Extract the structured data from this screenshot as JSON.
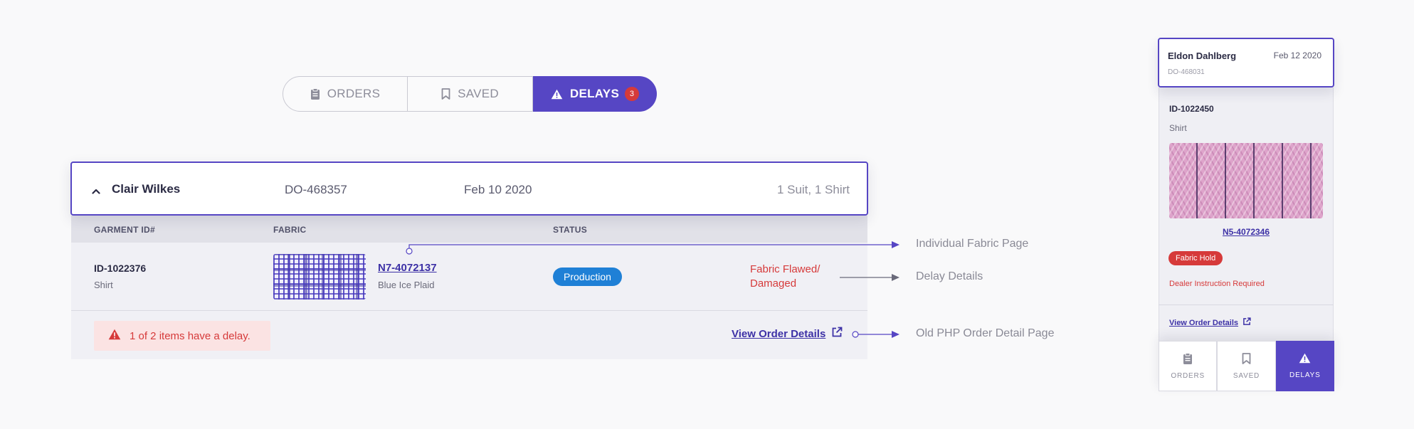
{
  "tabs": {
    "orders_label": "ORDERS",
    "saved_label": "SAVED",
    "delays_label": "DELAYS",
    "delays_count": "3",
    "active": "delays"
  },
  "order": {
    "customer": "Clair Wilkes",
    "order_id": "DO-468357",
    "date": "Feb 10 2020",
    "items_summary": "1 Suit, 1 Shirt",
    "columns": {
      "garment": "GARMENT ID#",
      "fabric": "FABRIC",
      "status": "STATUS"
    },
    "row": {
      "garment_id": "ID-1022376",
      "garment_type": "Shirt",
      "fabric_code": "N7-4072137",
      "fabric_name": "Blue Ice Plaid",
      "status": "Production",
      "delay_reason": "Fabric Flawed/ Damaged"
    },
    "alert_text": "1 of 2 items have a delay.",
    "view_order_label": "View Order Details"
  },
  "annotations": {
    "fabric_page": "Individual Fabric Page",
    "delay_details": "Delay Details",
    "old_php": "Old PHP Order Detail Page"
  },
  "mobile": {
    "customer": "Eldon Dahlberg",
    "date": "Feb 12 2020",
    "order_id": "DO-468031",
    "garment_id": "ID-1022450",
    "garment_type": "Shirt",
    "fabric_code": "N5-4072346",
    "hold_badge": "Fabric Hold",
    "instruction": "Dealer Instruction Required",
    "view_order_label": "View Order Details",
    "tabs": [
      "ORDERS",
      "SAVED",
      "DELAYS"
    ]
  },
  "colors": {
    "accent": "#5646c4",
    "danger": "#d63a3a",
    "status_blue": "#1f80d6",
    "link": "#3d31a6"
  },
  "icons": [
    "clipboard-icon",
    "bookmark-icon",
    "warning-icon",
    "chevron-up-icon",
    "external-link-icon"
  ]
}
